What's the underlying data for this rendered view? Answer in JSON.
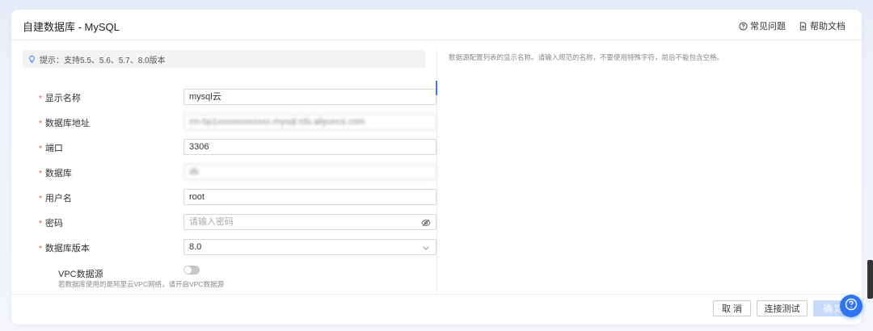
{
  "dialog": {
    "title": "自建数据库 - MySQL",
    "links": {
      "faq": "常见问题",
      "docs": "帮助文档"
    }
  },
  "tip": "提示：支持5.5、5.6、5.7、8.0版本",
  "help_text": "数据源配置列表的显示名称。请输入规范的名称，不要使用特殊字符，前后不能包含空格。",
  "form": {
    "display_name": {
      "label": "显示名称",
      "value": "mysql云"
    },
    "db_address": {
      "label": "数据库地址",
      "value": "rm-bp1xxxxxxxxxxxx.mysql.rds.aliyuncs.com"
    },
    "port": {
      "label": "端口",
      "value": "3306"
    },
    "database": {
      "label": "数据库",
      "value": "db"
    },
    "username": {
      "label": "用户名",
      "value": "root"
    },
    "password": {
      "label": "密码",
      "placeholder": "请输入密码"
    },
    "db_version": {
      "label": "数据库版本",
      "value": "8.0"
    },
    "vpc": {
      "label": "VPC数据源",
      "hint": "若数据库使用的是阿里云VPC网络，请开启VPC数据源",
      "enabled": false
    }
  },
  "buttons": {
    "cancel": "取 消",
    "test": "连接测试",
    "confirm": "确 定"
  },
  "colors": {
    "accent": "#2f74f5",
    "required": "#e8553a"
  }
}
